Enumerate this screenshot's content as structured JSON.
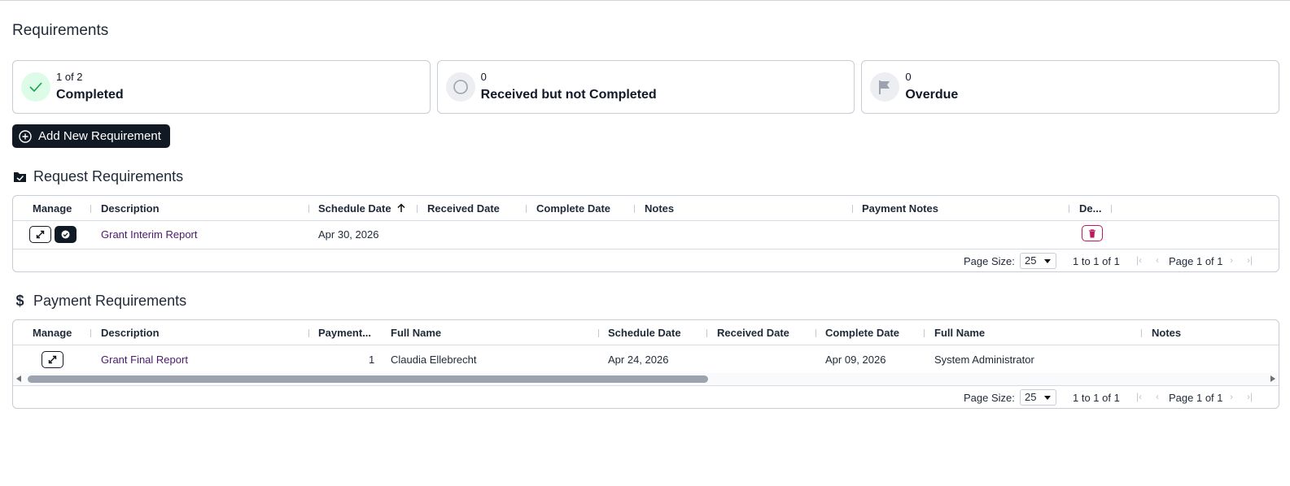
{
  "page": {
    "title": "Requirements"
  },
  "summary": [
    {
      "count": "1 of 2",
      "label": "Completed",
      "icon": "check-icon"
    },
    {
      "count": "0",
      "label": "Received but not Completed",
      "icon": "circle-icon"
    },
    {
      "count": "0",
      "label": "Overdue",
      "icon": "flag-icon"
    }
  ],
  "actions": {
    "add_label": "Add New Requirement"
  },
  "request_section": {
    "title": "Request Requirements",
    "columns": [
      "Manage",
      "Description",
      "Schedule Date",
      "Received Date",
      "Complete Date",
      "Notes",
      "Payment Notes",
      "De..."
    ],
    "rows": [
      {
        "description": "Grant Interim Report",
        "schedule_date": "Apr 30, 2026",
        "received_date": "",
        "complete_date": "",
        "notes": "",
        "payment_notes": ""
      }
    ],
    "footer": {
      "page_size_label": "Page Size:",
      "page_size": "25",
      "range": "1 to 1 of 1",
      "page": "Page 1 of 1"
    }
  },
  "payment_section": {
    "title": "Payment Requirements",
    "columns": [
      "Manage",
      "Description",
      "Payment...",
      "Full Name",
      "Schedule Date",
      "Received Date",
      "Complete Date",
      "Full Name",
      "Notes"
    ],
    "rows": [
      {
        "description": "Grant Final Report",
        "payment": "1",
        "full_name": "Claudia Ellebrecht",
        "schedule_date": "Apr 24, 2026",
        "received_date": "",
        "complete_date": "Apr 09, 2026",
        "full_name_2": "System Administrator",
        "notes": ""
      }
    ],
    "footer": {
      "page_size_label": "Page Size:",
      "page_size": "25",
      "range": "1 to 1 of 1",
      "page": "Page 1 of 1"
    }
  },
  "colors": {
    "dark": "#111a24",
    "link": "#4a1a6b",
    "danger": "#be185d",
    "success_bg": "#dcfce7"
  }
}
